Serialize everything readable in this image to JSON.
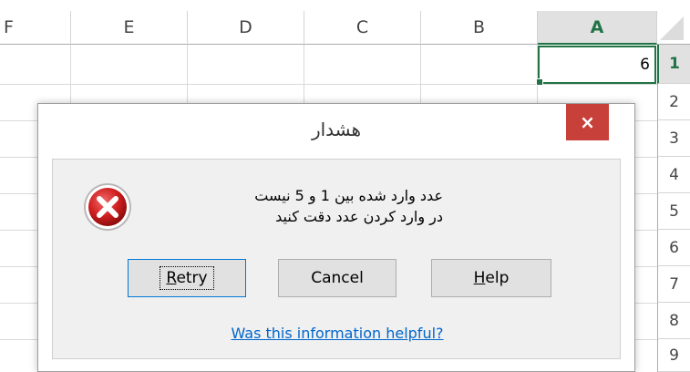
{
  "spreadsheet": {
    "columns": [
      "F",
      "E",
      "D",
      "C",
      "B",
      "A"
    ],
    "active_column": "A",
    "rows": [
      "1",
      "2",
      "3",
      "4",
      "5",
      "6",
      "7",
      "8",
      "9"
    ],
    "active_row": "1",
    "active_cell_value": "6",
    "accent_color": "#217346"
  },
  "dialog": {
    "title": "هشدار",
    "close_symbol": "×",
    "message_line1": "عدد وارد شده بین 1 و 5 نیست",
    "message_line2": "در وارد کردن عدد دقت کنید",
    "icon": "error-x-icon",
    "buttons": {
      "retry": {
        "mnemonic": "R",
        "rest": "etry"
      },
      "cancel": "Cancel",
      "help": {
        "mnemonic": "H",
        "rest": "elp"
      }
    },
    "help_link": "Was this information helpful?",
    "close_color": "#c8403a"
  }
}
